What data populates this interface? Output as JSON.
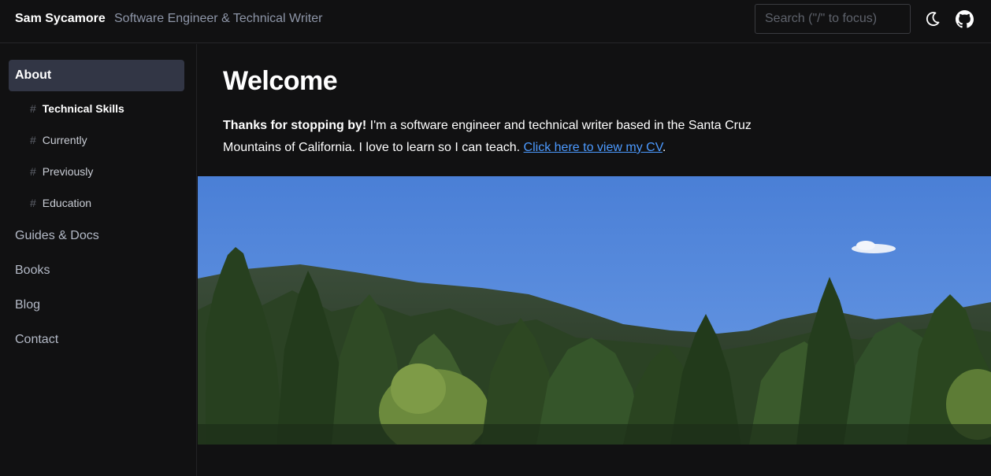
{
  "header": {
    "brand": "Sam Sycamore",
    "tagline": "Software Engineer & Technical Writer",
    "search_placeholder": "Search (\"/\" to focus)",
    "theme_icon": "moon-icon",
    "repo_icon": "github-icon"
  },
  "sidebar": {
    "active": "About",
    "sections": [
      {
        "label": "Technical Skills",
        "current": true
      },
      {
        "label": "Currently"
      },
      {
        "label": "Previously"
      },
      {
        "label": "Education"
      }
    ],
    "hash": "#",
    "items": [
      "Guides & Docs",
      "Books",
      "Blog",
      "Contact"
    ]
  },
  "main": {
    "title": "Welcome",
    "intro_bold": "Thanks for stopping by!",
    "intro_text": " I'm a software engineer and technical writer based in the Santa Cruz Mountains of California. I love to learn so I can teach. ",
    "cv_link": "Click here to view my CV",
    "intro_end": "."
  },
  "colors": {
    "background": "#111112",
    "accent_link": "#4c9aff",
    "active_nav": "#323645",
    "sky": "#4f86d9",
    "forest": "#2c4a22"
  }
}
